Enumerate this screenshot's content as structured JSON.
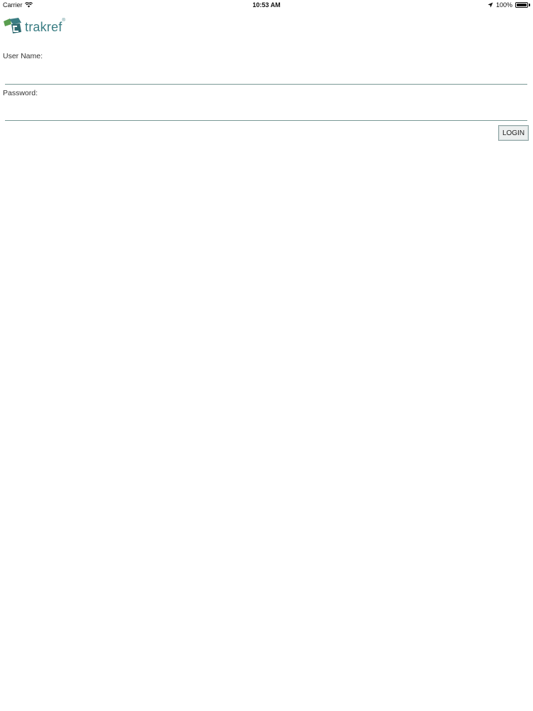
{
  "status_bar": {
    "carrier": "Carrier",
    "time": "10:53 AM",
    "battery": "100%",
    "battery_level": 1.0,
    "icons": [
      "wifi-icon",
      "location-arrow-icon",
      "battery-icon"
    ]
  },
  "logo": {
    "text": "trakref",
    "mark": "®",
    "brand_color": "#3a7d83",
    "accent_color": "#5a9e4f"
  },
  "form": {
    "username_label": "User Name:",
    "username_value": "",
    "password_label": "Password:",
    "password_value": "",
    "login_label": "LOGIN"
  }
}
